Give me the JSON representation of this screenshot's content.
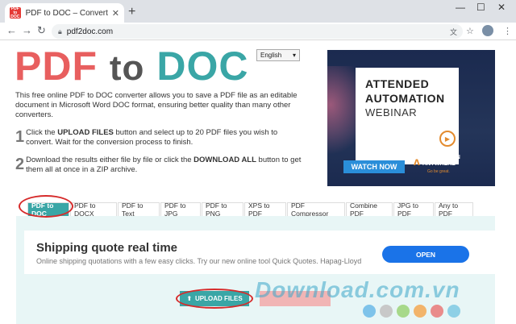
{
  "browser": {
    "tab_title": "PDF to DOC – Convert PDF to W",
    "favicon_text": "PDF to DOC",
    "url": "pdf2doc.com",
    "new_tab": "+",
    "close_tab": "✕",
    "minimize": "—",
    "maximize": "☐",
    "close_window": "✕",
    "back": "←",
    "forward": "→",
    "reload": "↻",
    "menu": "⋮",
    "star": "☆"
  },
  "page": {
    "logo_pdf": "PDF",
    "logo_to": "to",
    "logo_doc": "DOC",
    "language": "English",
    "intro": "This free online PDF to DOC converter allows you to save a PDF file as an editable document in Microsoft Word DOC format, ensuring better quality than many other converters.",
    "steps": [
      {
        "num": "1",
        "pre": "Click the ",
        "bold": "UPLOAD FILES",
        "post": " button and select up to 20 PDF files you wish to convert. Wait for the conversion process to finish."
      },
      {
        "num": "2",
        "pre": "Download the results either file by file or click the ",
        "bold": "DOWNLOAD ALL",
        "post": " button to get them all at once in a ZIP archive."
      }
    ]
  },
  "ad": {
    "line1": "ATTENDED",
    "line2": "AUTOMATION",
    "line3": "WEBINAR",
    "button": "WATCH NOW",
    "brand": "AUTOMATION ANYWHERE",
    "brand_line1": "AUTOMATION",
    "brand_line2": "ANYWHERE",
    "tagline": "Go be great."
  },
  "tool_tabs": [
    "PDF to DOC",
    "PDF to DOCX",
    "PDF to Text",
    "PDF to JPG",
    "PDF to PNG",
    "XPS to PDF",
    "PDF Compressor",
    "Combine PDF",
    "JPG to PDF",
    "Any to PDF"
  ],
  "active_tab": "PDF to DOC",
  "shipping_ad": {
    "title": "Shipping quote real time",
    "desc": "Online shipping quotations with a few easy clicks. Try our new online tool Quick Quotes. Hapag-Lloyd",
    "button": "OPEN"
  },
  "upload_label": "UPLOAD FILES",
  "watermark": "Download.com.vn",
  "colors": {
    "accent": "#3aa6a6",
    "logo_red": "#e85f5f",
    "highlight": "#d62b2b"
  }
}
